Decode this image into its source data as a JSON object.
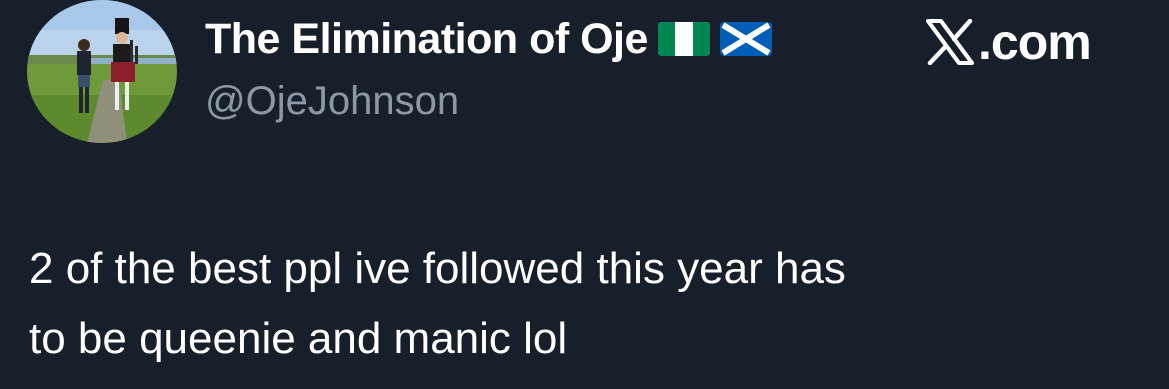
{
  "author": {
    "display_name": "The Elimination of Oje",
    "flags": [
      "nigeria-flag-icon",
      "scotland-flag-icon"
    ],
    "handle": "@OjeJohnson"
  },
  "brand": {
    "logo": "x-logo-icon",
    "text": ".com"
  },
  "tweet": {
    "text": "2 of the best ppl ive followed this year has\nto be queenie and manic lol"
  },
  "colors": {
    "background": "#17202a",
    "primary_text": "#ffffff",
    "secondary_text": "#8b98a5",
    "nigeria_green": "#008751",
    "scotland_blue": "#005eb8"
  }
}
